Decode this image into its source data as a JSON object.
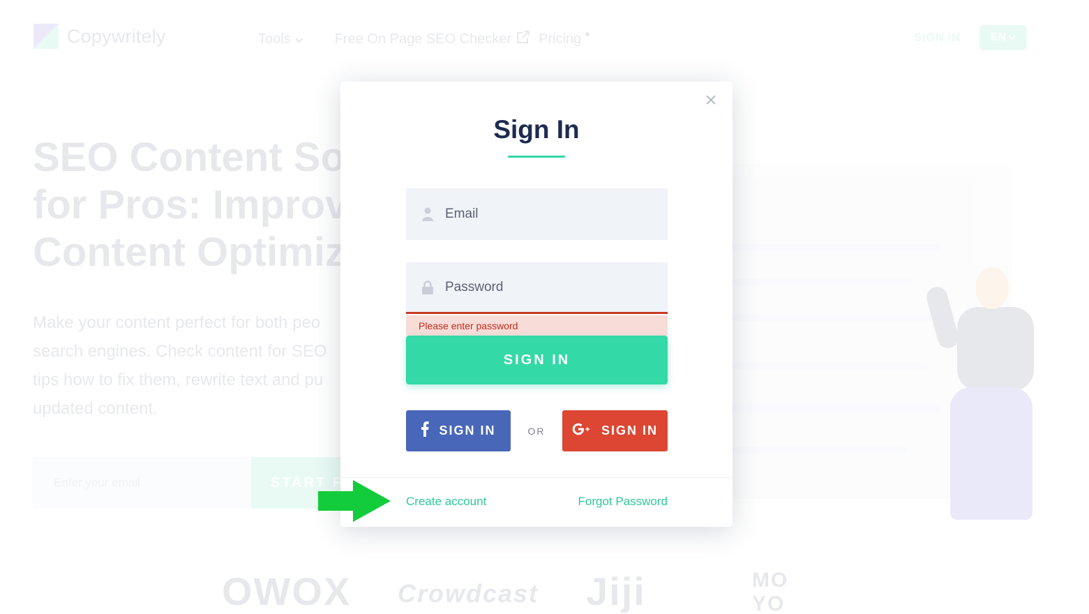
{
  "header": {
    "logo_text": "Copywritely",
    "nav": {
      "tools": "Tools",
      "checker": "Free On Page SEO Checker",
      "pricing": "Pricing"
    },
    "sign_in": "SIGN IN",
    "language": "EN"
  },
  "hero": {
    "title_line1": "SEO Content Soft",
    "title_line2": "for Pros: Improve",
    "title_line3": "Content Optimiza",
    "subtitle_line1": "Make your content perfect for both peo",
    "subtitle_line2": "search engines. Check content for SEO",
    "subtitle_line3": "tips how to fix them, rewrite text and pu",
    "subtitle_line4": "updated content.",
    "email_placeholder": "Enter your email",
    "start_button": "START FF"
  },
  "brands": [
    "OWOX",
    "Crowdcast",
    "Jiji",
    "MOYO"
  ],
  "modal": {
    "close_symbol": "×",
    "title": "Sign In",
    "email_placeholder": "Email",
    "email_value": "",
    "password_placeholder": "Password",
    "password_value": "",
    "password_error": "Please enter password",
    "sign_in_button": "SIGN IN",
    "facebook_button": "SIGN IN",
    "or_text": "OR",
    "google_button": "SIGN IN",
    "create_account": "Create account",
    "forgot_password": "Forgot Password"
  },
  "colors": {
    "accent": "#33d9a6",
    "navy": "#1e2b50",
    "facebook": "#4867b8",
    "google": "#dc4633",
    "error": "#c83a27",
    "annotation_arrow": "#12cc3c"
  },
  "icons": {
    "email_field": "user-icon",
    "password_field": "lock-icon",
    "facebook": "facebook-icon",
    "google": "google-plus-icon",
    "annotation": "arrow-right-icon"
  }
}
